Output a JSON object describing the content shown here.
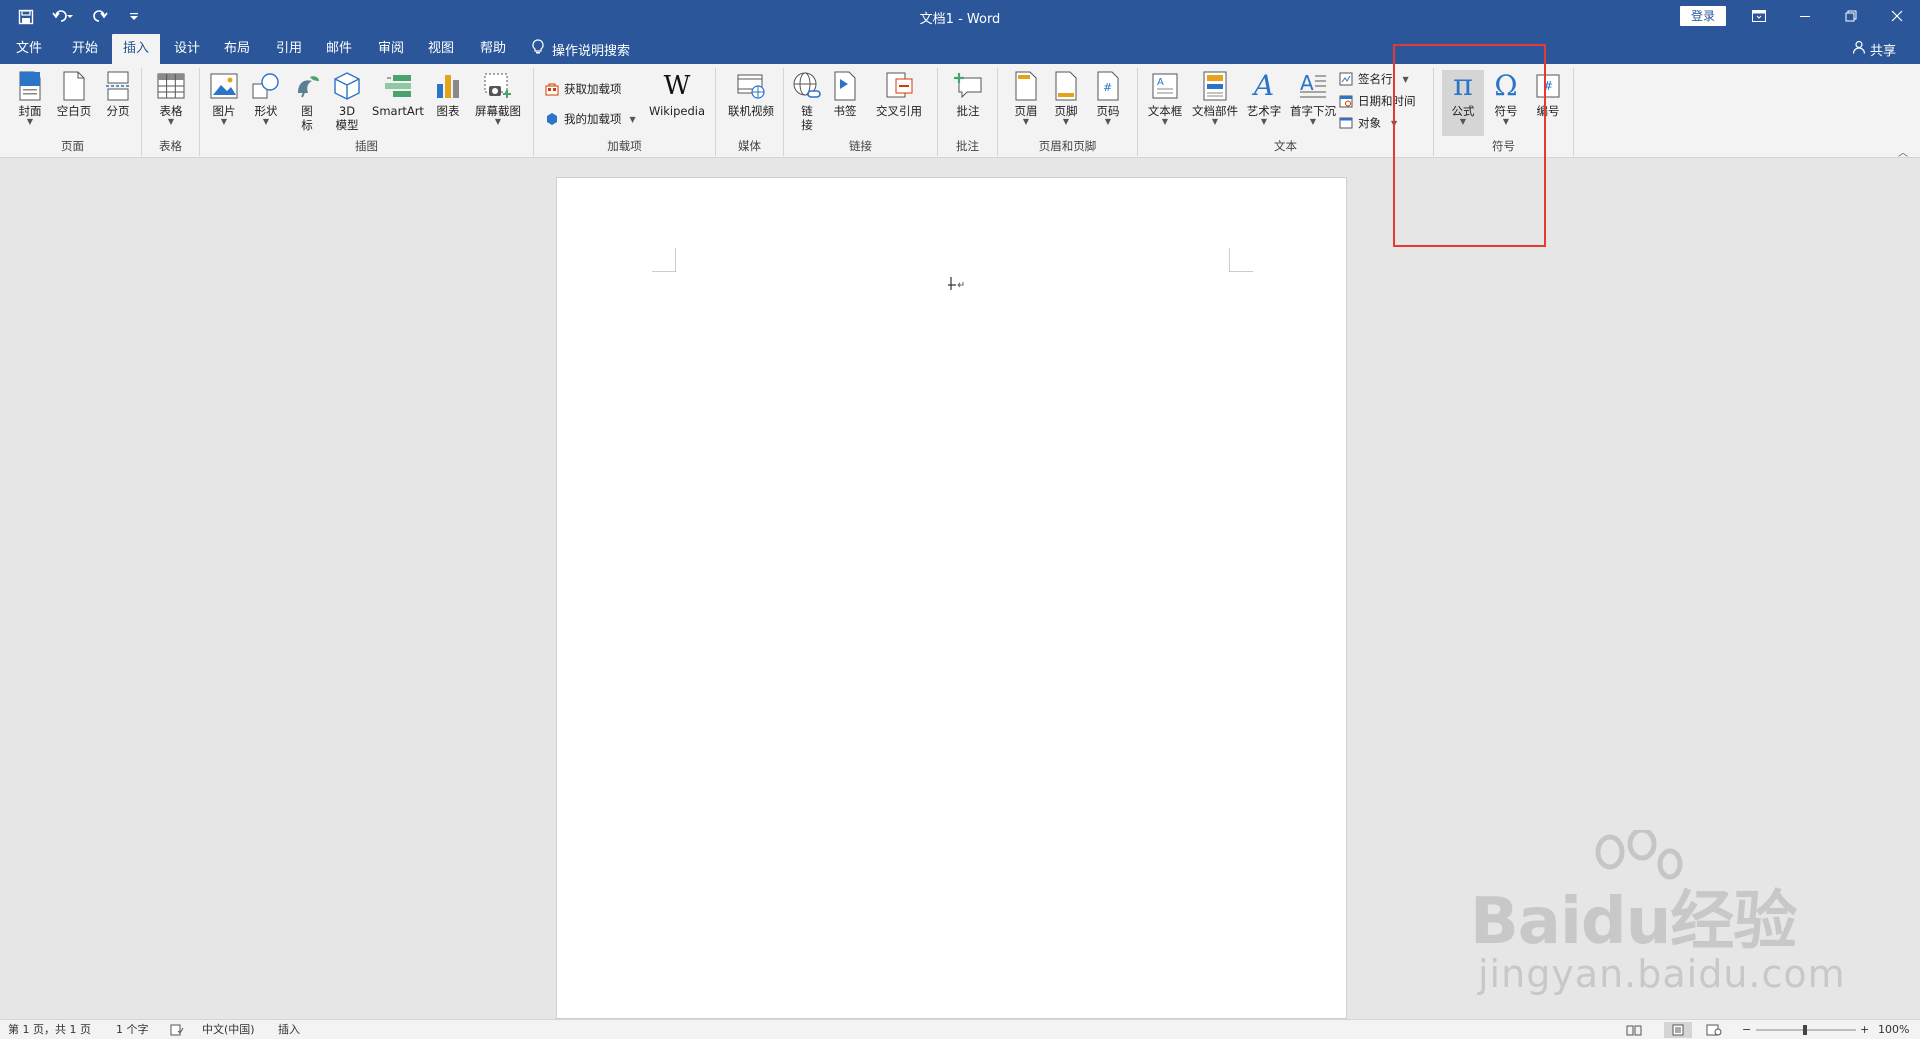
{
  "window": {
    "doc_title": "文档1 - Word",
    "login_label": "登录",
    "share_label": "共享"
  },
  "tabs": [
    "文件",
    "开始",
    "插入",
    "设计",
    "布局",
    "引用",
    "邮件",
    "审阅",
    "视图",
    "帮助"
  ],
  "active_tab": "插入",
  "tell_me": "操作说明搜索",
  "groups": {
    "pages": {
      "label": "页面",
      "items": [
        "封面",
        "空白页",
        "分页"
      ]
    },
    "tables": {
      "label": "表格",
      "items": [
        "表格"
      ]
    },
    "illustrations": {
      "label": "插图",
      "items": [
        "图片",
        "形状",
        "图\n标",
        "3D\n模型",
        "SmartArt",
        "图表",
        "屏幕截图"
      ]
    },
    "addins": {
      "label": "加载项",
      "get": "获取加载项",
      "my": "我的加载项",
      "wiki": "Wikipedia"
    },
    "media": {
      "label": "媒体",
      "items": [
        "联机视频"
      ]
    },
    "links": {
      "label": "链接",
      "items": [
        "链\n接",
        "书签",
        "交叉引用"
      ]
    },
    "comments": {
      "label": "批注",
      "items": [
        "批注"
      ]
    },
    "header_footer": {
      "label": "页眉和页脚",
      "items": [
        "页眉",
        "页脚",
        "页码"
      ]
    },
    "text": {
      "label": "文本",
      "items": [
        "文本框",
        "文档部件",
        "艺术字",
        "首字下沉"
      ],
      "small": [
        "签名行",
        "日期和时间",
        "对象"
      ]
    },
    "symbols": {
      "label": "符号",
      "items": [
        "公式",
        "符号",
        "编号"
      ]
    }
  },
  "status": {
    "page": "第 1 页，共 1 页",
    "words": "1 个字",
    "language": "中文(中国)",
    "mode": "插入",
    "zoom": "100%"
  },
  "watermark": {
    "main": "Baidu经验",
    "sub": "jingyan.baidu.com"
  },
  "colors": {
    "accent": "#2b579a",
    "highlight": "#e53935",
    "ribbon": "#f3f3f3"
  }
}
